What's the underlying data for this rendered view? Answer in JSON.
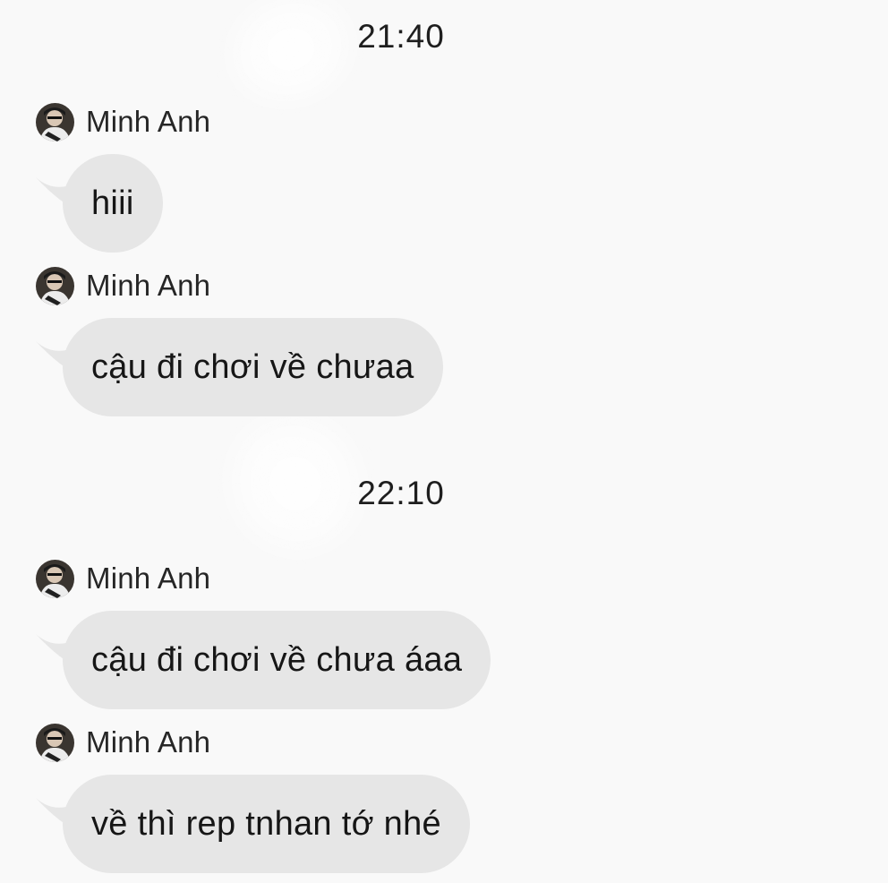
{
  "chat": {
    "groups": [
      {
        "time": "21:40"
      },
      {
        "time": "22:10"
      }
    ],
    "messages": [
      {
        "sender": "Minh Anh",
        "text": "hiii"
      },
      {
        "sender": "Minh Anh",
        "text": "cậu đi chơi về chưaa"
      },
      {
        "sender": "Minh Anh",
        "text": "cậu đi chơi về chưa áaa"
      },
      {
        "sender": "Minh Anh",
        "text": "về thì rep tnhan tớ nhé"
      }
    ]
  },
  "colors": {
    "background": "#f9f9f9",
    "bubble": "#e6e6e6",
    "text": "#161616"
  },
  "icons": {
    "avatar": "user-avatar-photo"
  }
}
